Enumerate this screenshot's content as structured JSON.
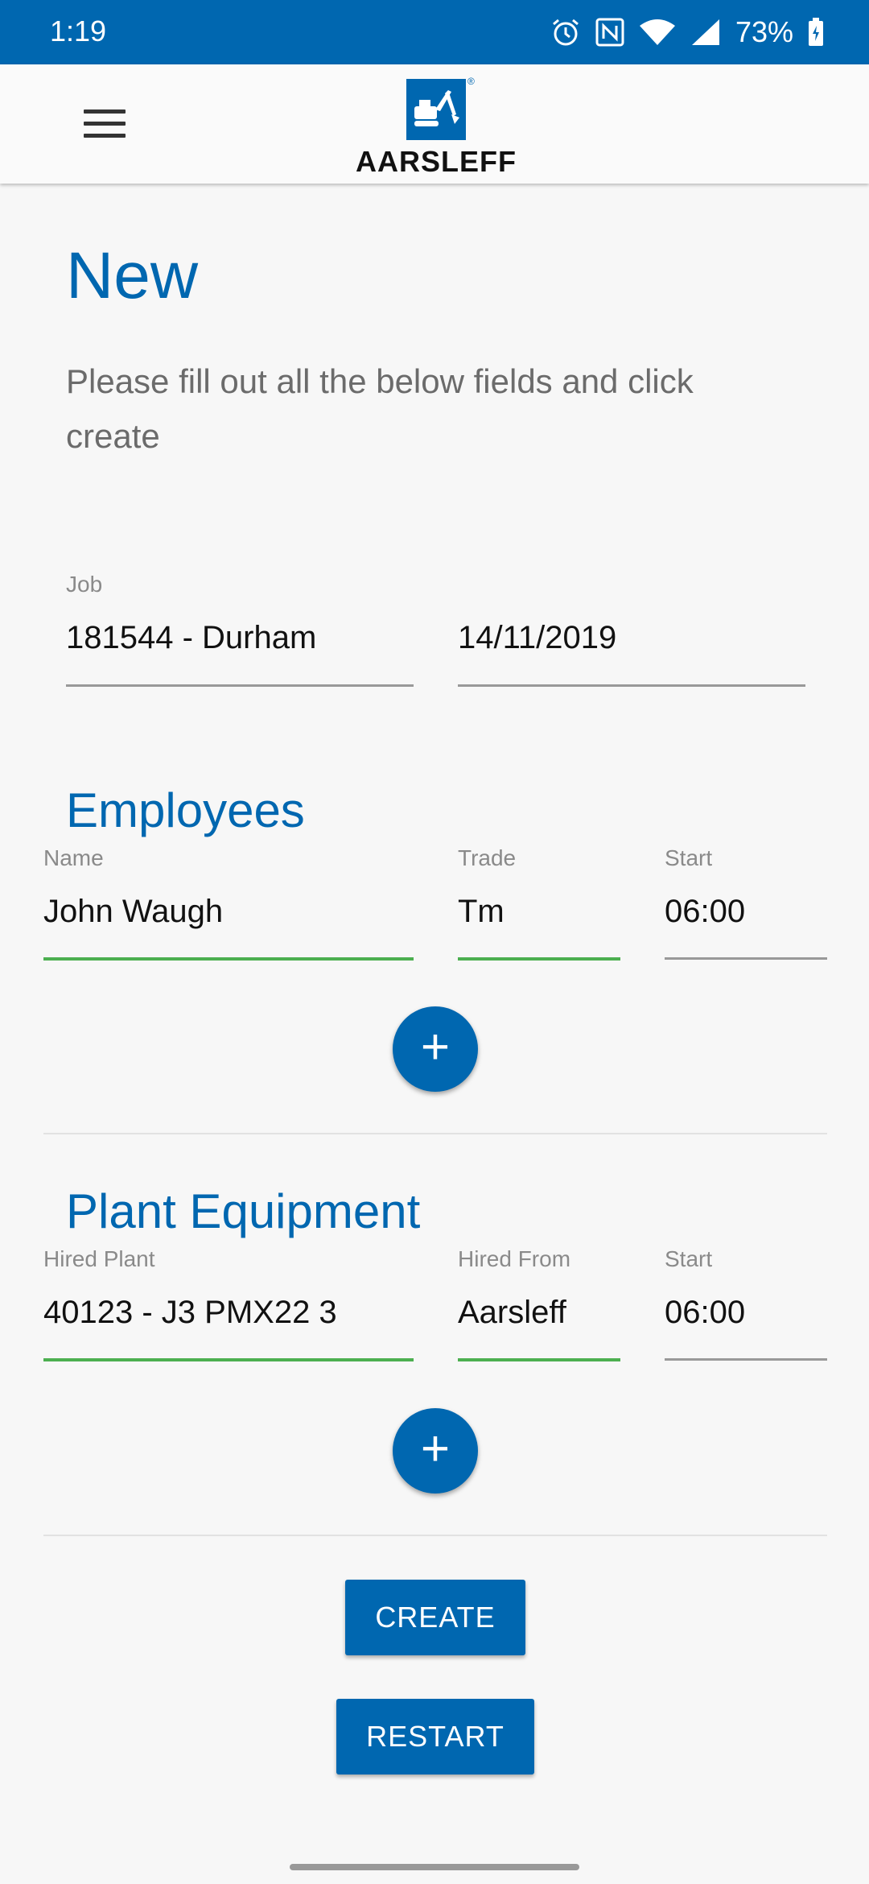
{
  "status_bar": {
    "time": "1:19",
    "battery": "73%",
    "icons": [
      "alarm-icon",
      "nfc-icon",
      "wifi-icon",
      "signal-icon",
      "battery-icon"
    ]
  },
  "app_bar": {
    "menu_icon": "hamburger-menu-icon",
    "logo_text": "AARSLEFF",
    "logo_icon": "excavator-logo-icon"
  },
  "page": {
    "title": "New",
    "intro": "Please fill out all the below fields and click create"
  },
  "job": {
    "label": "Job",
    "value": "181544 - Durham",
    "date": "14/11/2019"
  },
  "employees": {
    "title": "Employees",
    "name_label": "Name",
    "trade_label": "Trade",
    "start_label": "Start",
    "rows": [
      {
        "name": "John Waugh",
        "trade": "Tm",
        "start": "06:00"
      }
    ],
    "add_icon": "plus-icon"
  },
  "plant": {
    "title": "Plant Equipment",
    "hired_plant_label": "Hired Plant",
    "hired_from_label": "Hired From",
    "start_label": "Start",
    "rows": [
      {
        "hired_plant": "40123 - J3 PMX22 3",
        "hired_from": "Aarsleff",
        "start": "06:00"
      }
    ],
    "add_icon": "plus-icon"
  },
  "actions": {
    "create": "CREATE",
    "restart": "RESTART"
  },
  "colors": {
    "brand": "#0067b0",
    "valid_underline": "#4caf50",
    "text": "#111111",
    "muted": "#8a8a8a"
  }
}
